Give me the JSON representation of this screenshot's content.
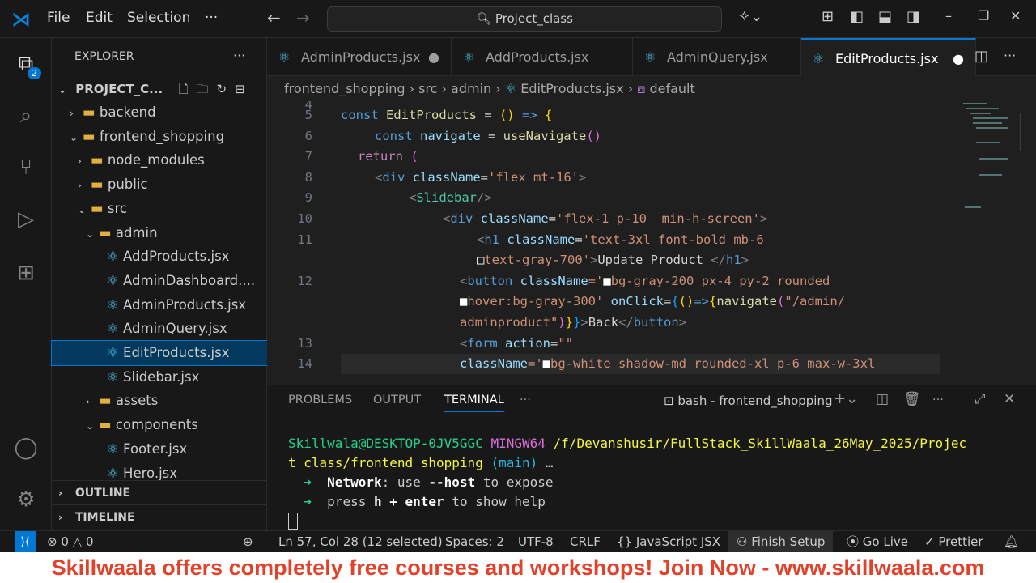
{
  "titlebar": {
    "menus": [
      "File",
      "Edit",
      "Selection",
      "···"
    ],
    "search": "Project_class"
  },
  "activity": {
    "badge": "2"
  },
  "explorer": {
    "title": "EXPLORER",
    "project": "PROJECT_C...",
    "items": [
      {
        "label": "backend",
        "type": "folder",
        "depth": 1,
        "open": false
      },
      {
        "label": "frontend_shopping",
        "type": "folder",
        "depth": 1,
        "open": true
      },
      {
        "label": "node_modules",
        "type": "folder",
        "depth": 2,
        "open": false
      },
      {
        "label": "public",
        "type": "folder",
        "depth": 2,
        "open": false
      },
      {
        "label": "src",
        "type": "folder",
        "depth": 2,
        "open": true
      },
      {
        "label": "admin",
        "type": "folder",
        "depth": 3,
        "open": true
      },
      {
        "label": "AddProducts.jsx",
        "type": "file",
        "depth": 4
      },
      {
        "label": "AdminDashboard....",
        "type": "file",
        "depth": 4
      },
      {
        "label": "AdminProducts.jsx",
        "type": "file",
        "depth": 4
      },
      {
        "label": "AdminQuery.jsx",
        "type": "file",
        "depth": 4
      },
      {
        "label": "EditProducts.jsx",
        "type": "file",
        "depth": 4,
        "selected": true
      },
      {
        "label": "Slidebar.jsx",
        "type": "file",
        "depth": 4
      },
      {
        "label": "assets",
        "type": "folder",
        "depth": 3,
        "open": false
      },
      {
        "label": "components",
        "type": "folder",
        "depth": 3,
        "open": true
      },
      {
        "label": "Footer.jsx",
        "type": "file",
        "depth": 4
      },
      {
        "label": "Hero.jsx",
        "type": "file",
        "depth": 4
      }
    ],
    "outline": "OUTLINE",
    "timeline": "TIMELINE"
  },
  "tabs": [
    {
      "label": "AdminProducts.jsx",
      "dirty": true
    },
    {
      "label": "AddProducts.jsx"
    },
    {
      "label": "AdminQuery.jsx"
    },
    {
      "label": "EditProducts.jsx",
      "dirty": true,
      "active": true
    }
  ],
  "breadcrumb": [
    "frontend_shopping",
    "src",
    "admin",
    "EditProducts.jsx",
    "default"
  ],
  "code": [
    {
      "n": "4",
      "t": []
    },
    {
      "n": "5",
      "i": 0,
      "t": [
        [
          "const ",
          "k"
        ],
        [
          "EditProducts",
          "f"
        ],
        [
          " = ",
          "t"
        ],
        [
          "()",
          "y"
        ],
        [
          " => ",
          "k"
        ],
        [
          "{",
          "y"
        ]
      ]
    },
    {
      "n": "6",
      "i": 42,
      "t": [
        [
          "const ",
          "k"
        ],
        [
          "navigate",
          "v"
        ],
        [
          " = ",
          "t"
        ],
        [
          "useNavigate",
          "f"
        ],
        [
          "()",
          "m"
        ]
      ]
    },
    {
      "n": "7",
      "i": 21,
      "t": [
        [
          "return ",
          "r"
        ],
        [
          "(",
          "m"
        ]
      ]
    },
    {
      "n": "8",
      "i": 42,
      "t": [
        [
          "<",
          "p"
        ],
        [
          "div ",
          "k"
        ],
        [
          "className",
          "v"
        ],
        [
          "=",
          "t"
        ],
        [
          "'flex mt-16'",
          "s"
        ],
        [
          ">",
          "p"
        ]
      ]
    },
    {
      "n": "9",
      "i": 84,
      "t": [
        [
          "<",
          "p"
        ],
        [
          "Slidebar",
          "c"
        ],
        [
          "/>",
          "p"
        ]
      ]
    },
    {
      "n": "10",
      "i": 126,
      "t": [
        [
          "<",
          "p"
        ],
        [
          "div ",
          "k"
        ],
        [
          "className",
          "v"
        ],
        [
          "=",
          "t"
        ],
        [
          "'flex-1 p-10  min-h-screen'",
          "s"
        ],
        [
          ">",
          "p"
        ]
      ]
    },
    {
      "n": "11",
      "i": 168,
      "t": [
        [
          "<",
          "p"
        ],
        [
          "h1 ",
          "k"
        ],
        [
          "className",
          "v"
        ],
        [
          "=",
          "t"
        ],
        [
          "'text-3xl font-bold mb-6",
          "s"
        ]
      ]
    },
    {
      "n": "",
      "i": 168,
      "t": [
        [
          "□",
          "sw"
        ],
        [
          "text-gray-700'",
          "s"
        ],
        [
          ">",
          "p"
        ],
        [
          "Update Product ",
          "t"
        ],
        [
          "</",
          "p"
        ],
        [
          "h1",
          "k"
        ],
        [
          ">",
          "p"
        ]
      ]
    },
    {
      "n": "12",
      "i": 147,
      "t": [
        [
          "<",
          "p"
        ],
        [
          "button ",
          "k"
        ],
        [
          "className",
          "v"
        ],
        [
          "='",
          "s"
        ],
        [
          "■",
          "sw"
        ],
        [
          "bg-gray-200 px-4 py-2 rounded",
          "s"
        ]
      ]
    },
    {
      "n": "",
      "i": 147,
      "t": [
        [
          "■",
          "sw"
        ],
        [
          "hover:bg-gray-300' ",
          "s"
        ],
        [
          "onClick",
          "v"
        ],
        [
          "=",
          "t"
        ],
        [
          "{",
          "b"
        ],
        [
          "()",
          "y"
        ],
        [
          "=>",
          "k"
        ],
        [
          "{",
          "y"
        ],
        [
          "navigate",
          "f"
        ],
        [
          "(",
          "m"
        ],
        [
          "\"/admin/",
          "s"
        ]
      ]
    },
    {
      "n": "",
      "i": 147,
      "t": [
        [
          "adminproduct\"",
          "s"
        ],
        [
          ")",
          "m"
        ],
        [
          "}",
          "y"
        ],
        [
          "}",
          "b"
        ],
        [
          ">",
          "p"
        ],
        [
          "Back",
          "t"
        ],
        [
          "</",
          "p"
        ],
        [
          "button",
          "k"
        ],
        [
          ">",
          "p"
        ]
      ]
    },
    {
      "n": "13",
      "i": 147,
      "t": [
        [
          "<",
          "p"
        ],
        [
          "form ",
          "k"
        ],
        [
          "action",
          "v"
        ],
        [
          "=",
          "t"
        ],
        [
          "\"\"",
          "s"
        ]
      ]
    },
    {
      "n": "14",
      "i": 147,
      "t": [
        [
          "className",
          "v"
        ],
        [
          "='",
          "s"
        ],
        [
          "■",
          "sw"
        ],
        [
          "bg-white shadow-md rounded-xl p-6 max-w-3xl",
          "s"
        ]
      ]
    }
  ],
  "panel": {
    "tabs": [
      "PROBLEMS",
      "OUTPUT",
      "TERMINAL",
      "···"
    ],
    "shell": "bash - frontend_shopping",
    "terminal": {
      "user": "Skillwala@DESKTOP-0JV5GGC",
      "env": "MINGW64",
      "path": "/f/Devanshusir/FullStack_SkillWaala_26May_2025/Projec",
      "path2": "t_class/frontend_shopping",
      "branch": "(main)",
      "ellipsis": "…",
      "l1a": "Network",
      "l1b": ": use ",
      "l1c": "--host",
      "l1d": " to expose",
      "l2a": "press ",
      "l2b": "h + enter",
      "l2c": " to show help",
      "arrow": "➜"
    }
  },
  "status": {
    "errors": "0",
    "warnings": "0",
    "position": "Ln 57, Col 28 (12 selected)",
    "spaces": "Spaces: 2",
    "encoding": "UTF-8",
    "eol": "CRLF",
    "language": "JavaScript JSX",
    "finish": "Finish Setup",
    "golive": "Go Live",
    "prettier": "Prettier"
  },
  "banner": "Skillwaala offers completely free courses and workshops! Join Now - www.skillwaala.com"
}
